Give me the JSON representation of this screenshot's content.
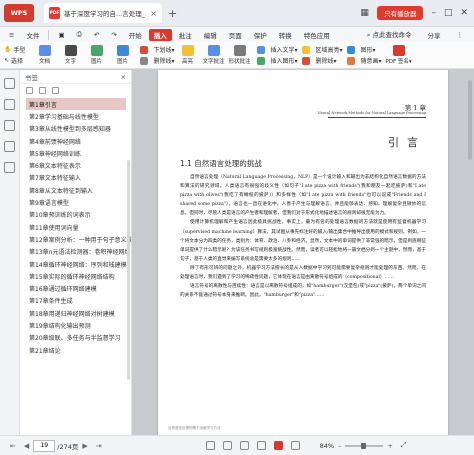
{
  "titlebar": {
    "app_label": "WPS",
    "tab_title": "基于深度学习的自...言处理_.pdf",
    "tab_icon_label": "PDF",
    "tab_close": "×",
    "new_tab": "+",
    "login_label": "只有播放器"
  },
  "menubar": {
    "file": "文件",
    "items": [
      "开始",
      "插入",
      "批注",
      "编辑",
      "页面",
      "保护",
      "转换",
      "特色应用"
    ],
    "active_index": 1,
    "search_label": "点此查找命令",
    "right_items": [
      "分享",
      "⋮"
    ]
  },
  "ribbon": {
    "hand": "手型",
    "select": "选择",
    "buttons": [
      "文档",
      "文字",
      "图片",
      "图片",
      "删除文本",
      "删除",
      "区域",
      "替换",
      "标注",
      "删除",
      "高亮",
      "文字批注",
      "形状批注"
    ],
    "group1_rows": [
      "下划线▾",
      "删除线▾"
    ],
    "group2_rows": [
      "插入文字▾",
      "插入图形▾"
    ],
    "group3_rows": [
      "区域高亮▾",
      "删除线▾"
    ],
    "right": [
      "图形▾",
      "随意画▾",
      "PDF 签名▾"
    ]
  },
  "sidebar": {
    "header": "书签",
    "close": "×",
    "items": [
      "第1章引言",
      "第2章学习基础与线性模型",
      "第3章从线性模型到多层感知器",
      "第4章前馈神经网络",
      "第5章神经网络训练",
      "第6章文本特征表示",
      "第7章文本特征输入",
      "第8章从文本特征到输入",
      "第9章语言模型",
      "第10章预训练的词表示",
      "第11章使用词向量",
      "第12章案例分析：一种用于句子意义推理...",
      "第13章n元语法检测器：卷积神经网络",
      "第14章循环神经网络：序列和栈建模",
      "第15章实际的循环神经网络结构",
      "第16章通过循环网络建模",
      "第17章条件生成",
      "第18章用递归神经网络对树建模",
      "第19章结构化输出预测",
      "第20章级联、多任务与半监督学习",
      "第21章结论"
    ],
    "active_index": 0
  },
  "page": {
    "chapter_no": "第 1 章",
    "chapter_sub": "Neural Network Methods for Natural Language Processing",
    "chapter_title": "引言",
    "section_title": "1.1  自然语言处理的挑战",
    "paragraphs": [
      "自然语言处理（Natural Language Processing，NLP）是一个设计输入和输出为非结构化自然语言数据的方法和算法的研究领域。人类语言有很强的歧义性（如句子\"I ate pizza with friends\"(我和朋友一起吃披萨)和\"I ate pizza with olives\"(我吃了有橄榄的披萨)）和多样性（如\"I ate pizza with friends\"也可以说成\"Friends and I shared some pizza\"）。语言也一直在进化中。人善于产生与理解语言，并且能够表达、感知、理解复杂且微妙的信息。但同时，尽管人类是语言的产生者和理解者，但我们对于形式化地描述语言的规则却很无能为力。",
      "使用计算机理解和产生语言因此极具挑战性。事实上，最为有名的处理语言数据的方法就是使用有监督机器学习（supervised machine learning）算法，其试图从事先标注好的输入/输出集合中推导出使用的模式和规则。例如，一个将文本分为四类的任务，类别为：体育、政治、八卦和经济。显然，文本中的单词提供了非常强的暗示，但是到底哪些单词提供了什么暗示呢？为该任务书写规则极富挑战性。然而，读者可以轻松地将一篇文档分到一个主题中，然而，基于句子，基于人类的直觉来编写系统总是需要太多的规则……",
      "除了有形可辨的问题之外，机器学习方法擅长的是从人数据中学习到可能需要复杂规则才能处理的东西。然而，在处理语言时，我们遇到了学习的稀疏性问题，它体现在语言是由离散符号组成的（compositional）……",
      "语言符号的离散性与连续性：语言是以离散符号组成的，如\"hamburger\"(汉堡包)或\"pizza\"(披萨)，两个单词之间的关系不能通过符号本身来推断。因此，\"hamburger\"和\"pizza\"……"
    ],
    "footer": "自然语言处理的基于深度学习方法"
  },
  "statusbar": {
    "current_page": "19",
    "total_pages": "/274页",
    "zoom": "84%",
    "zoom_level": 0.4
  }
}
